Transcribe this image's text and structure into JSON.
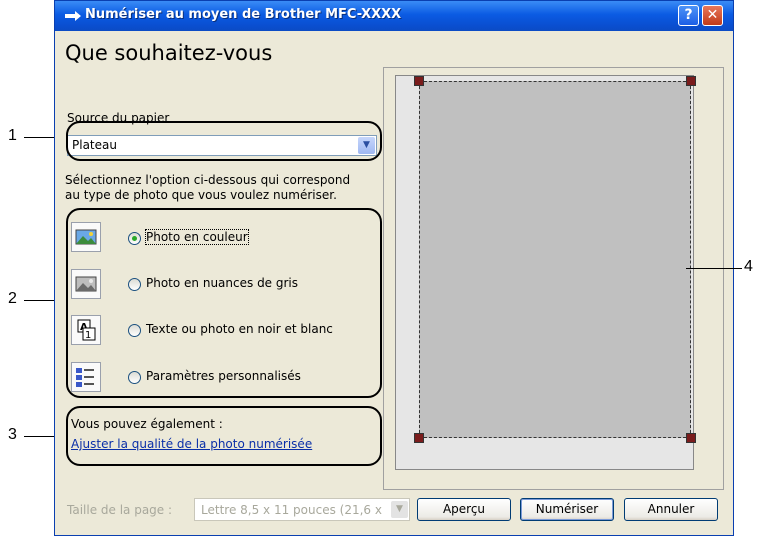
{
  "window": {
    "title": "Numériser au moyen de Brother MFC-XXXX",
    "help_label": "?",
    "close_label": "✕"
  },
  "main": {
    "heading": "Que souhaitez-vous",
    "paper_source_label": "Source du papier",
    "paper_source_value": "Plateau",
    "instructions_line1": "Sélectionnez l'option ci-dessous qui correspond",
    "instructions_line2": "au type de photo que vous voulez numériser.",
    "options": [
      {
        "label": "Photo en couleur",
        "selected": true,
        "icon": "color-photo-icon"
      },
      {
        "label": "Photo en nuances de gris",
        "selected": false,
        "icon": "grayscale-photo-icon"
      },
      {
        "label": "Texte ou photo en noir et blanc",
        "selected": false,
        "icon": "black-white-text-icon"
      },
      {
        "label": "Paramètres personnalisés",
        "selected": false,
        "icon": "custom-settings-icon"
      }
    ],
    "also_label": "Vous pouvez également :",
    "adjust_link": "Ajuster la qualité de la photo numérisée"
  },
  "footer": {
    "page_size_label": "Taille de la page :",
    "page_size_value": "Lettre 8,5 x 11 pouces (21,6 x",
    "preview_button": "Aperçu",
    "scan_button": "Numériser",
    "cancel_button": "Annuler"
  },
  "callouts": [
    "1",
    "2",
    "3",
    "4"
  ],
  "colors": {
    "titlebar": "#0b5be3",
    "dialog_bg": "#ece9d8",
    "link": "#0a2fa8",
    "close_button": "#c13a18",
    "handle": "#7a1c1c"
  }
}
